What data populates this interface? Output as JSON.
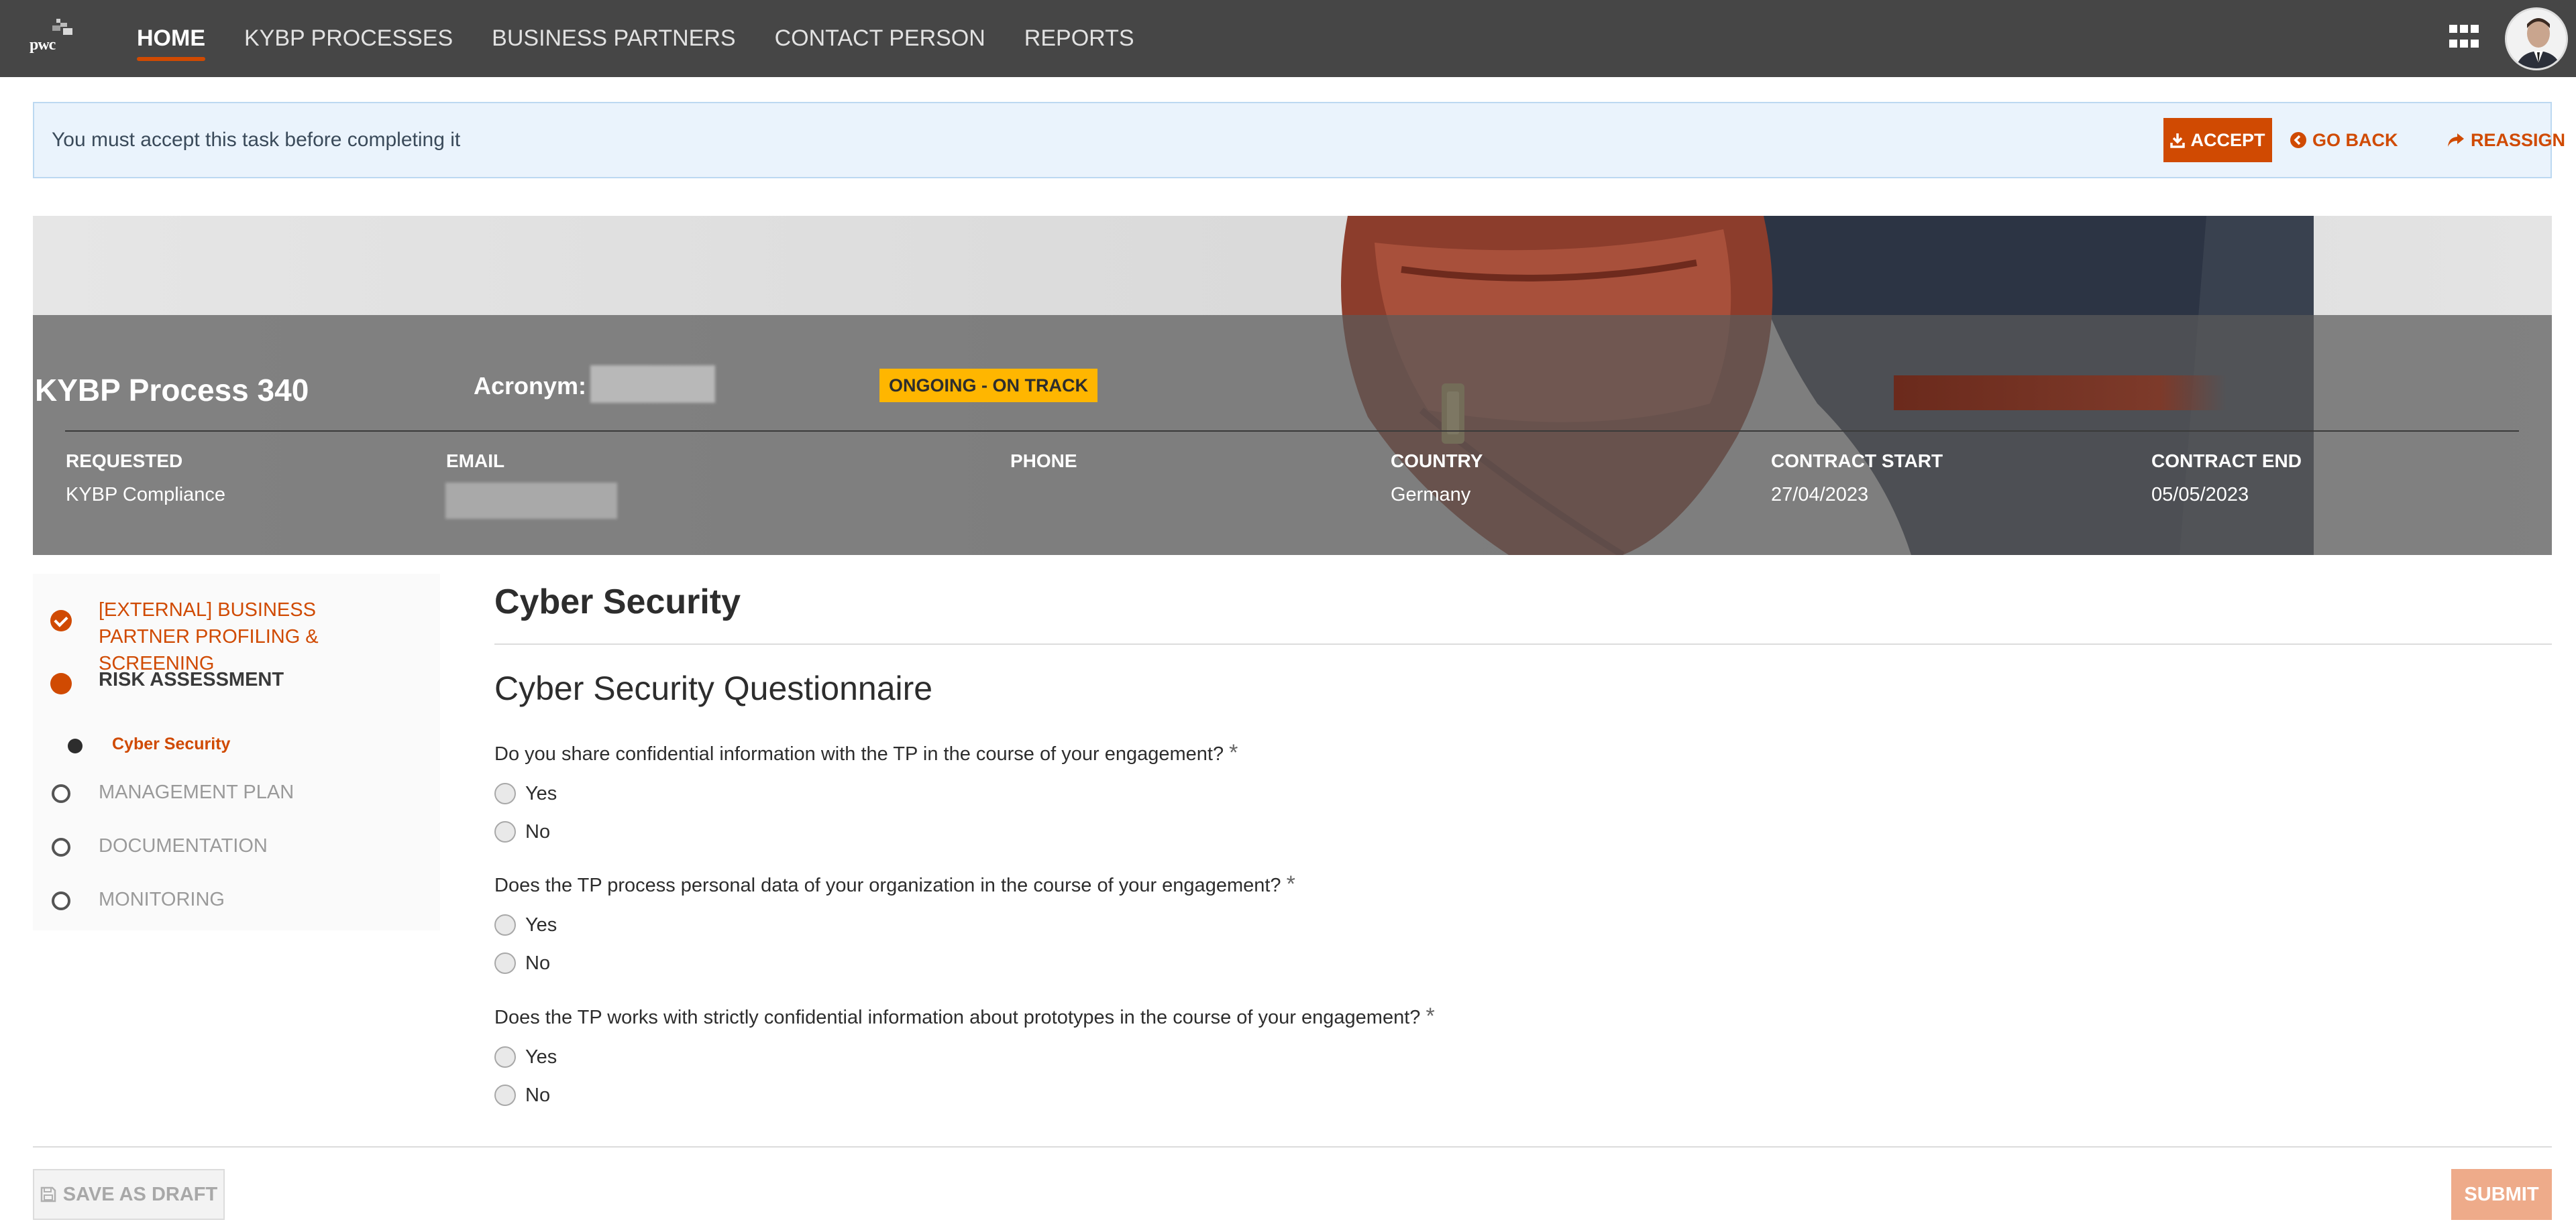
{
  "brand": {
    "logo_text": "pwc",
    "accent": "#d04a02",
    "status_color": "#ffb600"
  },
  "nav": {
    "items": [
      {
        "label": "HOME",
        "active": true
      },
      {
        "label": "KYBP PROCESSES"
      },
      {
        "label": "BUSINESS PARTNERS"
      },
      {
        "label": "CONTACT PERSON"
      },
      {
        "label": "REPORTS"
      }
    ],
    "apps_icon": "grid-icon",
    "avatar_icon": "user-avatar"
  },
  "alert": {
    "message": "You must accept this task before completing it",
    "accept_label": "ACCEPT",
    "go_back_label": "GO BACK",
    "reassign_label": "REASSIGN"
  },
  "process": {
    "title": "KYBP Process 340",
    "acronym_label": "Acronym:",
    "status": "ONGOING - ON TRACK",
    "fields": {
      "requested": {
        "label": "REQUESTED",
        "value": "KYBP Compliance"
      },
      "email": {
        "label": "EMAIL",
        "value": ""
      },
      "phone": {
        "label": "PHONE",
        "value": ""
      },
      "country": {
        "label": "COUNTRY",
        "value": "Germany"
      },
      "contract_start": {
        "label": "CONTRACT START",
        "value": "27/04/2023"
      },
      "contract_end": {
        "label": "CONTRACT END",
        "value": "05/05/2023"
      }
    }
  },
  "stepper": {
    "steps": [
      {
        "label": "[EXTERNAL] BUSINESS PARTNER PROFILING & SCREENING",
        "state": "done"
      },
      {
        "label": "RISK ASSESSMENT",
        "state": "active"
      },
      {
        "label": "MANAGEMENT PLAN",
        "state": "pending"
      },
      {
        "label": "DOCUMENTATION",
        "state": "pending"
      },
      {
        "label": "MONITORING",
        "state": "pending"
      }
    ],
    "sub_step": "Cyber Security"
  },
  "form": {
    "section_title": "Cyber Security",
    "questionnaire_title": "Cyber Security Questionnaire",
    "required_mark": "*",
    "questions": [
      {
        "text": "Do you share confidential information with the TP in the course of your engagement?",
        "options": [
          "Yes",
          "No"
        ]
      },
      {
        "text": "Does the TP process personal data of your organization in the course of your engagement?",
        "options": [
          "Yes",
          "No"
        ]
      },
      {
        "text": "Does the TP works with strictly confidential information about prototypes in the course of your engagement?",
        "options": [
          "Yes",
          "No"
        ]
      }
    ],
    "save_draft_label": "SAVE AS DRAFT",
    "submit_label": "SUBMIT"
  }
}
